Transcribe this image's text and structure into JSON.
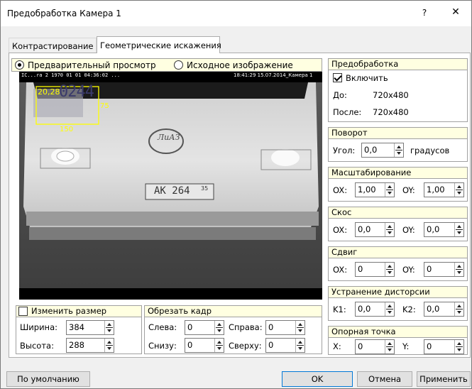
{
  "window": {
    "title": "Предобработка Камера 1",
    "help_glyph": "?",
    "close_glyph": "✕"
  },
  "tabs": [
    {
      "label": "Контрастирование"
    },
    {
      "label": "Геометрические искажения"
    }
  ],
  "preview": {
    "mode_preview": "Предварительный просмотр",
    "mode_original": "Исходное изображение",
    "selected": "preview",
    "overlay_left": "IC...ra 2 1970 01 01 04:36:02 ...",
    "overlay_right": "18:41:29 15.07.2014_Камера 1",
    "roi_coords": "20,28",
    "roi_width": "150",
    "roi_height": "75",
    "bus_number": "0244",
    "brand": "ЛиАЗ",
    "plate": "АК 264",
    "plate_region": "35"
  },
  "resize": {
    "label": "Изменить размер",
    "checked": false,
    "width_label": "Ширина:",
    "width": "384",
    "height_label": "Высота:",
    "height": "288"
  },
  "crop": {
    "title": "Обрезать кадр",
    "left_label": "Слева:",
    "left": "0",
    "right_label": "Справа:",
    "right": "0",
    "bottom_label": "Снизу:",
    "bottom": "0",
    "top_label": "Сверху:",
    "top": "0"
  },
  "preprocess": {
    "title": "Предобработка",
    "enable_label": "Включить",
    "enabled": true,
    "before_label": "До:",
    "before": "720x480",
    "after_label": "После:",
    "after": "720x480"
  },
  "rotation": {
    "title": "Поворот",
    "angle_label": "Угол:",
    "angle": "0,0",
    "unit": "градусов"
  },
  "scale": {
    "title": "Масштабирование",
    "ox_label": "OX:",
    "ox": "1,00",
    "oy_label": "OY:",
    "oy": "1,00"
  },
  "skew": {
    "title": "Скос",
    "ox_label": "OX:",
    "ox": "0,0",
    "oy_label": "OY:",
    "oy": "0,0"
  },
  "shift": {
    "title": "Сдвиг",
    "ox_label": "OX:",
    "ox": "0",
    "oy_label": "OY:",
    "oy": "0"
  },
  "distortion": {
    "title": "Устранение дисторсии",
    "k1_label": "K1:",
    "k1": "0,0",
    "k2_label": "K2:",
    "k2": "0,0"
  },
  "ref_point": {
    "title": "Опорная точка",
    "x_label": "X:",
    "x": "0",
    "y_label": "Y:",
    "y": "0"
  },
  "buttons": {
    "defaults": "По умолчанию",
    "ok": "OK",
    "cancel": "Отмена",
    "apply": "Применить"
  },
  "colors": {
    "roi": "#ffff00",
    "group_header": "#ffffe1",
    "default_button_border": "#0078d7"
  }
}
